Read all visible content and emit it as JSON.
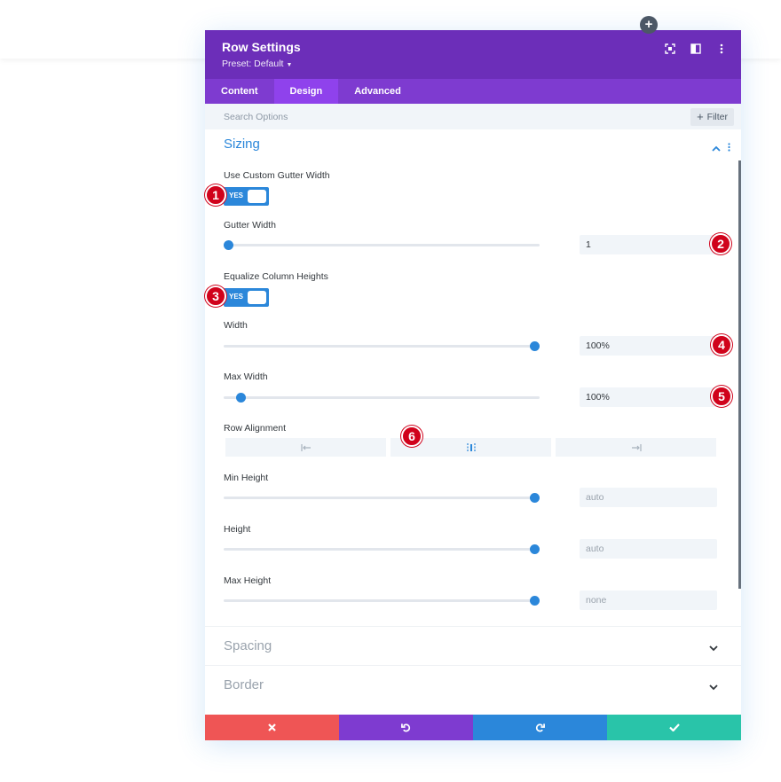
{
  "modal": {
    "title": "Row Settings",
    "preset": "Preset: Default"
  },
  "tabs": [
    {
      "label": "Content",
      "active": false
    },
    {
      "label": "Design",
      "active": true
    },
    {
      "label": "Advanced",
      "active": false
    }
  ],
  "search": {
    "placeholder": "Search Options",
    "filter_label": "Filter"
  },
  "sizing": {
    "title": "Sizing",
    "use_custom_gutter_label": "Use Custom Gutter Width",
    "use_custom_gutter_value": "YES",
    "gutter_width_label": "Gutter Width",
    "gutter_width_value": "1",
    "equalize_label": "Equalize Column Heights",
    "equalize_value": "YES",
    "width_label": "Width",
    "width_value": "100%",
    "max_width_label": "Max Width",
    "max_width_value": "100%",
    "row_alignment_label": "Row Alignment",
    "row_alignment_selected": "center",
    "min_height_label": "Min Height",
    "min_height_value": "auto",
    "height_label": "Height",
    "height_value": "auto",
    "max_height_label": "Max Height",
    "max_height_value": "none"
  },
  "sliders": {
    "gutter_width": 0.0,
    "width": 1.0,
    "max_width": 0.04,
    "min_height": 1.0,
    "height": 1.0,
    "max_height": 1.0
  },
  "collapsed_sections": [
    {
      "label": "Spacing"
    },
    {
      "label": "Border"
    }
  ],
  "badges": [
    "1",
    "2",
    "3",
    "4",
    "5",
    "6"
  ],
  "icons": {
    "add": "plus-icon",
    "header": [
      "fullscreen-icon",
      "split-view-icon",
      "more-vertical-icon"
    ],
    "footer": [
      "close-icon",
      "undo-icon",
      "redo-icon",
      "check-icon"
    ]
  },
  "colors": {
    "header": "#6c2eb9",
    "tabs": "#7e3bd0",
    "active_tab": "#8f42ec",
    "accent": "#2b87da",
    "cancel": "#ef5555",
    "undo": "#7e3bd0",
    "redo": "#2b87da",
    "save": "#29c4a9",
    "badge": "#d0021b"
  }
}
